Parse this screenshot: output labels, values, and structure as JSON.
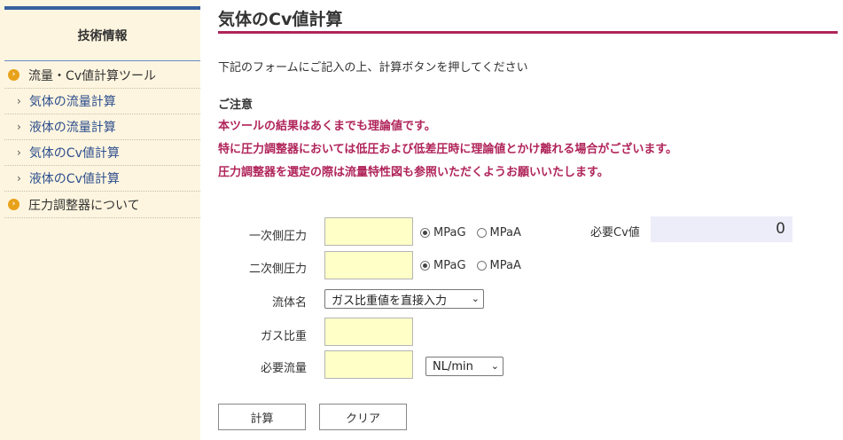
{
  "sidebar": {
    "header": "技術情報",
    "menu": [
      {
        "label": "流量・Cv値計算ツール",
        "icon": "circle-chevron-icon"
      },
      {
        "label": "圧力調整器について",
        "icon": "circle-chevron-icon"
      }
    ],
    "sub_items": [
      {
        "label": "気体の流量計算"
      },
      {
        "label": "液体の流量計算"
      },
      {
        "label": "気体のCv値計算"
      },
      {
        "label": "液体のCv値計算"
      }
    ]
  },
  "main": {
    "title": "気体のCv値計算",
    "intro": "下記のフォームにご記入の上、計算ボタンを押してください",
    "notice": {
      "title": "ご注意",
      "lines": [
        "本ツールの結果はあくまでも理論値です。",
        "特に圧力調整器においては低圧および低差圧時に理論値とかけ離れる場合がございます。",
        "圧力調整器を選定の際は流量特性図も参照いただくようお願いいたします。"
      ]
    },
    "form": {
      "primary_pressure": {
        "label": "一次側圧力",
        "value": "",
        "units": [
          "MPaG",
          "MPaA"
        ],
        "selected_unit": "MPaG"
      },
      "secondary_pressure": {
        "label": "二次側圧力",
        "value": "",
        "units": [
          "MPaG",
          "MPaA"
        ],
        "selected_unit": "MPaG"
      },
      "fluid": {
        "label": "流体名",
        "selected": "ガス比重値を直接入力"
      },
      "gas_gravity": {
        "label": "ガス比重",
        "value": ""
      },
      "flow": {
        "label": "必要流量",
        "value": "",
        "unit": "NL/min"
      }
    },
    "result": {
      "label": "必要Cv値",
      "value": "0"
    },
    "buttons": {
      "calculate": "計算",
      "clear": "クリア"
    }
  },
  "colors": {
    "accent": "#b0245a",
    "sidebar_bg": "#fdf5df",
    "input_bg": "#ffffc8",
    "result_bg": "#ecedf8",
    "link": "#2e4f8f",
    "bullet": "#e8a21a"
  }
}
